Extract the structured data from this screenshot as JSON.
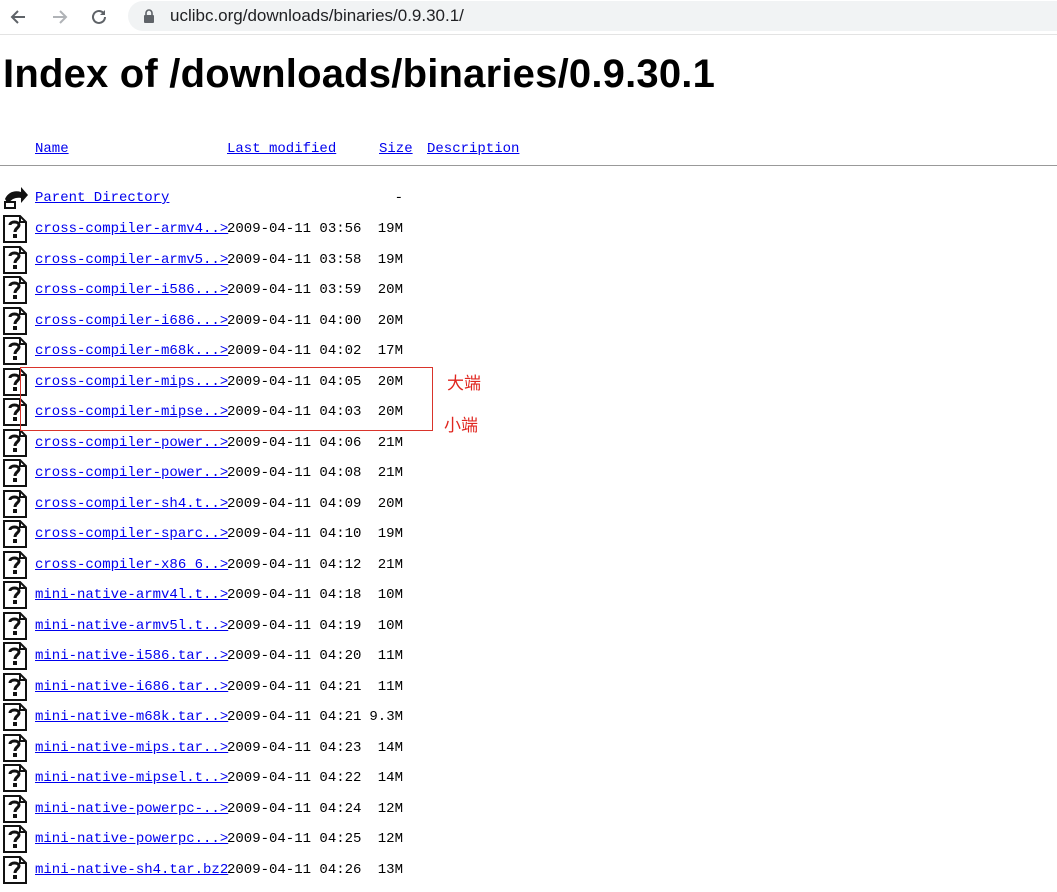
{
  "browser": {
    "url": "uclibc.org/downloads/binaries/0.9.30.1/"
  },
  "page": {
    "title": "Index of /downloads/binaries/0.9.30.1",
    "columns": {
      "name": "Name",
      "last_modified": "Last modified",
      "size": "Size",
      "description": "Description"
    },
    "parent": {
      "name": "Parent Directory",
      "size": "-"
    },
    "rows": [
      {
        "name": "cross-compiler-armv4..>",
        "date": "2009-04-11 03:56",
        "size": "19M"
      },
      {
        "name": "cross-compiler-armv5..>",
        "date": "2009-04-11 03:58",
        "size": "19M"
      },
      {
        "name": "cross-compiler-i586...>",
        "date": "2009-04-11 03:59",
        "size": "20M"
      },
      {
        "name": "cross-compiler-i686...>",
        "date": "2009-04-11 04:00",
        "size": "20M"
      },
      {
        "name": "cross-compiler-m68k...>",
        "date": "2009-04-11 04:02",
        "size": "17M"
      },
      {
        "name": "cross-compiler-mips...>",
        "date": "2009-04-11 04:05",
        "size": "20M"
      },
      {
        "name": "cross-compiler-mipse..>",
        "date": "2009-04-11 04:03",
        "size": "20M"
      },
      {
        "name": "cross-compiler-power..>",
        "date": "2009-04-11 04:06",
        "size": "21M"
      },
      {
        "name": "cross-compiler-power..>",
        "date": "2009-04-11 04:08",
        "size": "21M"
      },
      {
        "name": "cross-compiler-sh4.t..>",
        "date": "2009-04-11 04:09",
        "size": "20M"
      },
      {
        "name": "cross-compiler-sparc..>",
        "date": "2009-04-11 04:10",
        "size": "19M"
      },
      {
        "name": "cross-compiler-x86_6..>",
        "date": "2009-04-11 04:12",
        "size": "21M"
      },
      {
        "name": "mini-native-armv4l.t..>",
        "date": "2009-04-11 04:18",
        "size": "10M"
      },
      {
        "name": "mini-native-armv5l.t..>",
        "date": "2009-04-11 04:19",
        "size": "10M"
      },
      {
        "name": "mini-native-i586.tar..>",
        "date": "2009-04-11 04:20",
        "size": "11M"
      },
      {
        "name": "mini-native-i686.tar..>",
        "date": "2009-04-11 04:21",
        "size": "11M"
      },
      {
        "name": "mini-native-m68k.tar..>",
        "date": "2009-04-11 04:21",
        "size": "9.3M"
      },
      {
        "name": "mini-native-mips.tar..>",
        "date": "2009-04-11 04:23",
        "size": "14M"
      },
      {
        "name": "mini-native-mipsel.t..>",
        "date": "2009-04-11 04:22",
        "size": "14M"
      },
      {
        "name": "mini-native-powerpc-..>",
        "date": "2009-04-11 04:24",
        "size": "12M"
      },
      {
        "name": "mini-native-powerpc...>",
        "date": "2009-04-11 04:25",
        "size": "12M"
      },
      {
        "name": "mini-native-sh4.tar.bz2",
        "date": "2009-04-11 04:26",
        "size": "13M"
      }
    ]
  },
  "annotations": {
    "big_endian": "大端",
    "little_endian": "小端",
    "color": "#e0261f"
  },
  "colors": {
    "link": "#0000ee",
    "toolbar_field": "#f1f3f4"
  },
  "icons": {
    "back": "arrow-left-icon",
    "forward": "arrow-right-icon",
    "reload": "reload-icon",
    "lock": "lock-icon",
    "parent": "back-arrow-folder-icon",
    "file": "unknown-file-icon"
  }
}
